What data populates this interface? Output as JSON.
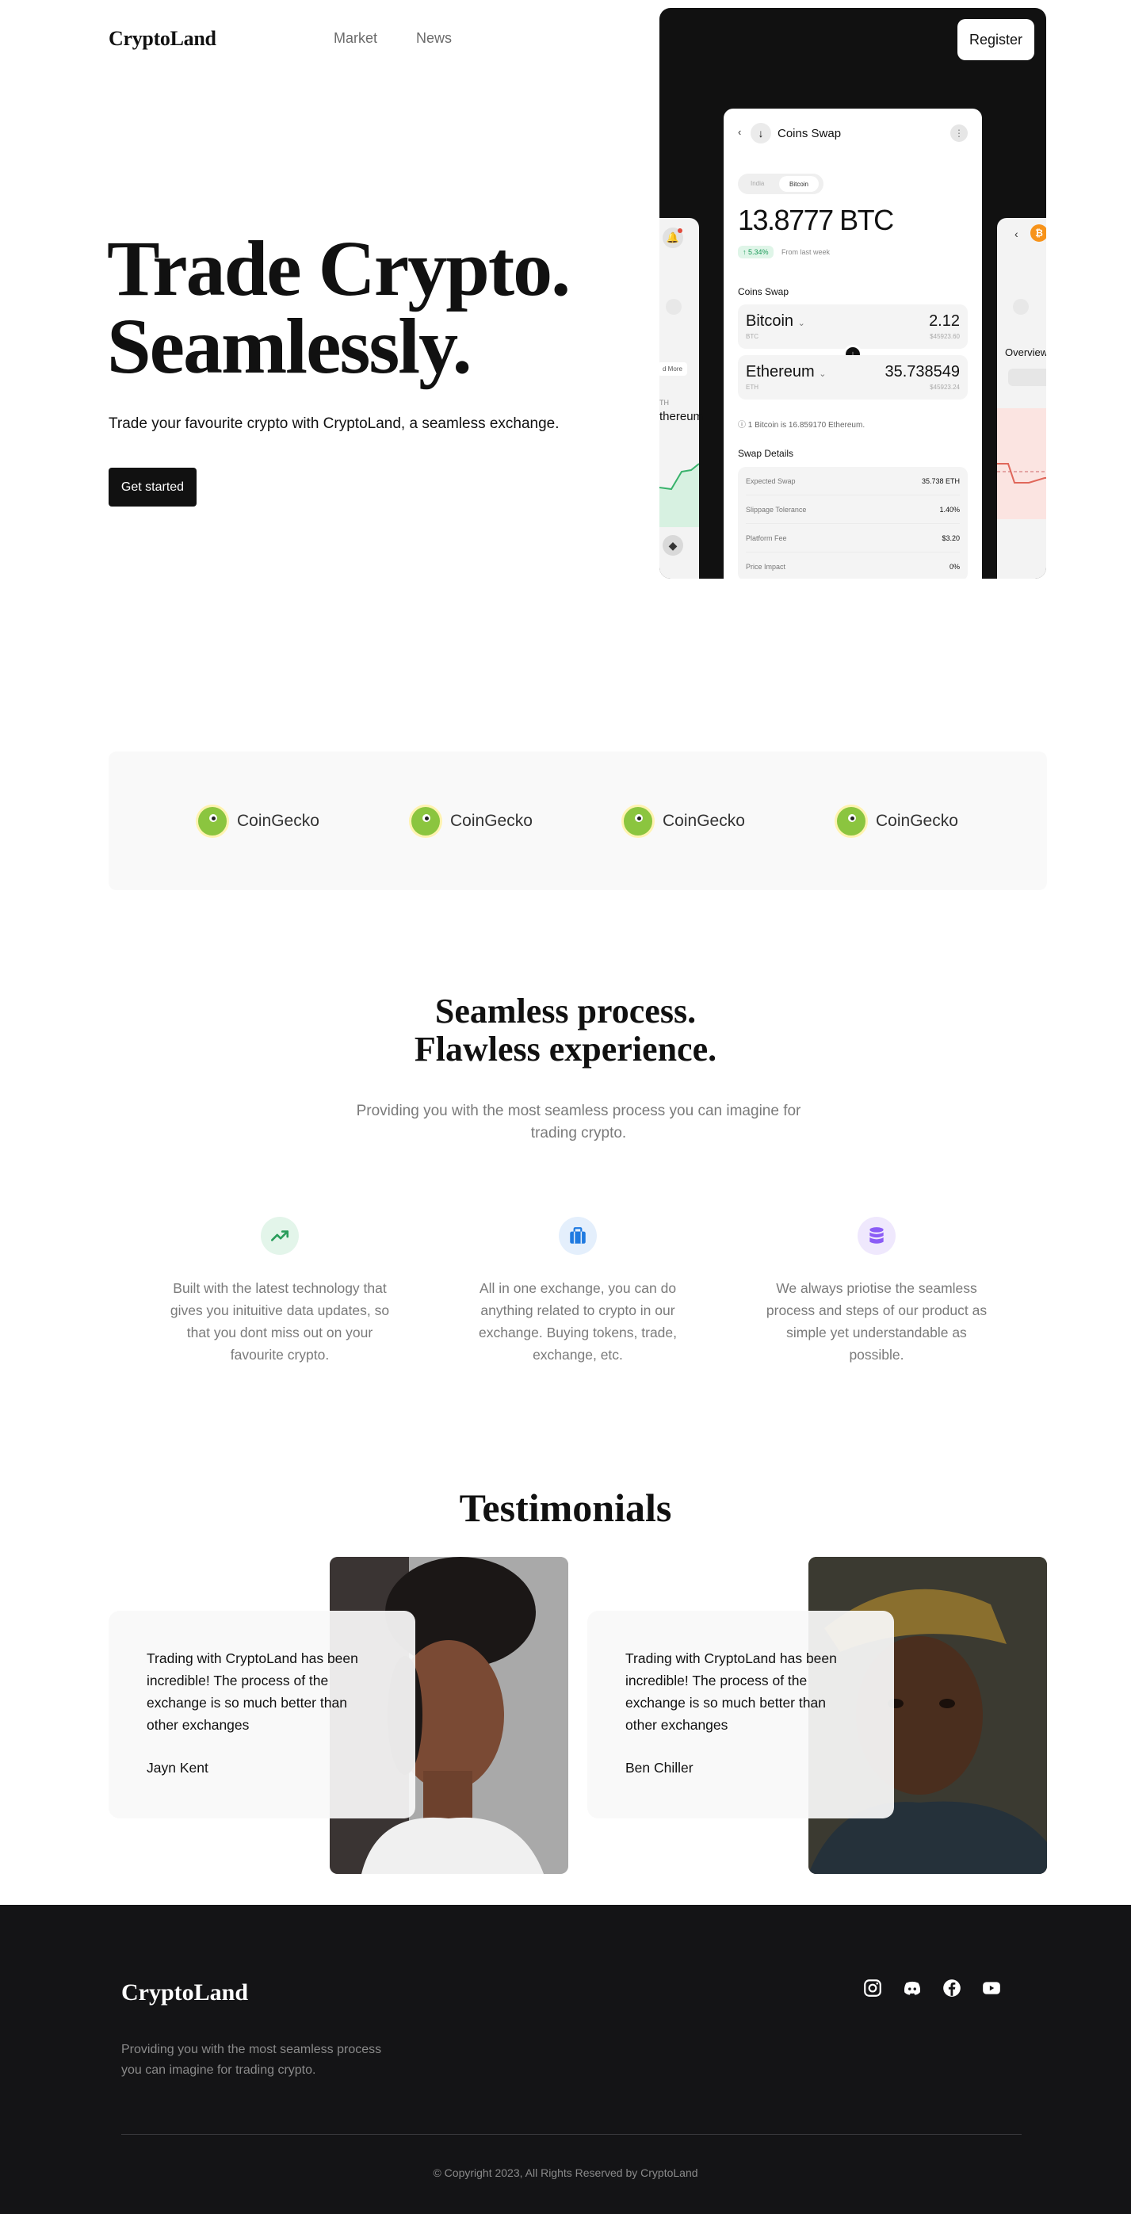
{
  "header": {
    "logo": "CryptoLand",
    "nav": [
      "Market",
      "News"
    ],
    "register": "Register"
  },
  "hero": {
    "title_line1": "Trade Crypto.",
    "title_line2": "Seamlessly.",
    "subtitle": "Trade your favourite crypto with CryptoLand, a seamless exchange.",
    "cta": "Get started"
  },
  "mockup": {
    "app_title": "Coins Swap",
    "toggle_left": "India",
    "toggle_right": "Bitcoin",
    "balance": "13.8777 BTC",
    "change_badge": "↑ 5.34%",
    "change_period": "From last week",
    "swap_section": "Coins Swap",
    "from_coin": "Bitcoin",
    "from_symbol": "BTC",
    "from_amount": "2.12",
    "from_usd": "$45923.60",
    "to_coin": "Ethereum",
    "to_symbol": "ETH",
    "to_amount": "35.738549",
    "to_usd": "$45923.24",
    "rate_text": "1 Bitcoin is 16.859170 Ethereum.",
    "details_section": "Swap Details",
    "details": [
      {
        "label": "Expected Swap",
        "value": "35.738 ETH"
      },
      {
        "label": "Slippage Tolerance",
        "value": "1.40%"
      },
      {
        "label": "Platform Fee",
        "value": "$3.20"
      },
      {
        "label": "Price Impact",
        "value": "0%"
      }
    ],
    "left_card_more": "d More",
    "left_card_sym": "TH",
    "left_card_name": "Ethereum",
    "right_card_overview": "Overview"
  },
  "partners": [
    "CoinGecko",
    "CoinGecko",
    "CoinGecko",
    "CoinGecko"
  ],
  "process": {
    "title_line1": "Seamless process.",
    "title_line2": "Flawless experience.",
    "subtitle": "Providing you with the most seamless process you can imagine for trading crypto.",
    "features": [
      {
        "icon": "trending-up-icon",
        "color": "#2a9d5c",
        "bg": "#e3f5ea",
        "text": "Built with the latest technology that gives you inituitive data updates, so that you dont miss out on your favourite crypto."
      },
      {
        "icon": "briefcase-icon",
        "color": "#1f7ae0",
        "bg": "#e4effc",
        "text": "All in one exchange, you can do anything related to crypto in our exchange. Buying tokens, trade, exchange, etc."
      },
      {
        "icon": "database-icon",
        "color": "#8b5cf6",
        "bg": "#efe8fd",
        "text": "We always priotise the seamless process and steps of our product as simple yet understandable as possible."
      }
    ]
  },
  "testimonials": {
    "title": "Testimonials",
    "items": [
      {
        "quote": "Trading with CryptoLand has been incredible! The process of the exchange is so much better than other exchanges",
        "name": "Jayn Kent"
      },
      {
        "quote": "Trading with CryptoLand has been incredible! The process of the exchange is so much better than other exchanges",
        "name": "Ben Chiller"
      }
    ]
  },
  "footer": {
    "logo": "CryptoLand",
    "description": "Providing you with the most seamless process you can imagine for trading crypto.",
    "socials": [
      "instagram-icon",
      "discord-icon",
      "facebook-icon",
      "youtube-icon"
    ],
    "copyright": "© Copyright 2023, All Rights Reserved by CryptoLand"
  }
}
